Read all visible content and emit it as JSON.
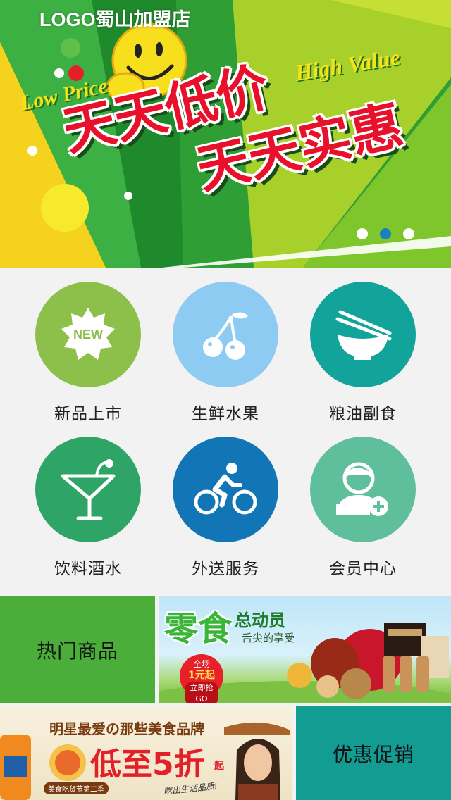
{
  "banner": {
    "logo": "LOGO蜀山加盟店",
    "script_left": "Low Price",
    "script_right": "High Value",
    "slogan_line1": "天天低价",
    "slogan_line2": "天天实惠",
    "dots": 3,
    "active_dot": 2
  },
  "categories": [
    {
      "label": "新品上市",
      "icon": "new-badge-icon",
      "color": "#8dc04b",
      "icon_text": "NEW"
    },
    {
      "label": "生鲜水果",
      "icon": "cherry-icon",
      "color": "#8ecbf2"
    },
    {
      "label": "粮油副食",
      "icon": "bowl-chopsticks-icon",
      "color": "#12a39b"
    },
    {
      "label": "饮料酒水",
      "icon": "cocktail-icon",
      "color": "#2ea566"
    },
    {
      "label": "外送服务",
      "icon": "cyclist-icon",
      "color": "#1276b6"
    },
    {
      "label": "会员中心",
      "icon": "member-add-icon",
      "color": "#5fbf9c"
    }
  ],
  "tiles": {
    "hot": "热门商品",
    "sale": "优惠促销"
  },
  "promo1": {
    "title": "零食",
    "subtitle": "总动员",
    "tagline": "舌尖的享受",
    "badge_top": "全场",
    "badge_mid": "1元起",
    "badge_btn": "立即抢GO"
  },
  "promo2": {
    "headline": "明星最爱の那些美食品牌",
    "big": "低至5折",
    "suffix": "起",
    "footer": "吃出生活品质!",
    "tag": "美食吃货节第二季"
  }
}
